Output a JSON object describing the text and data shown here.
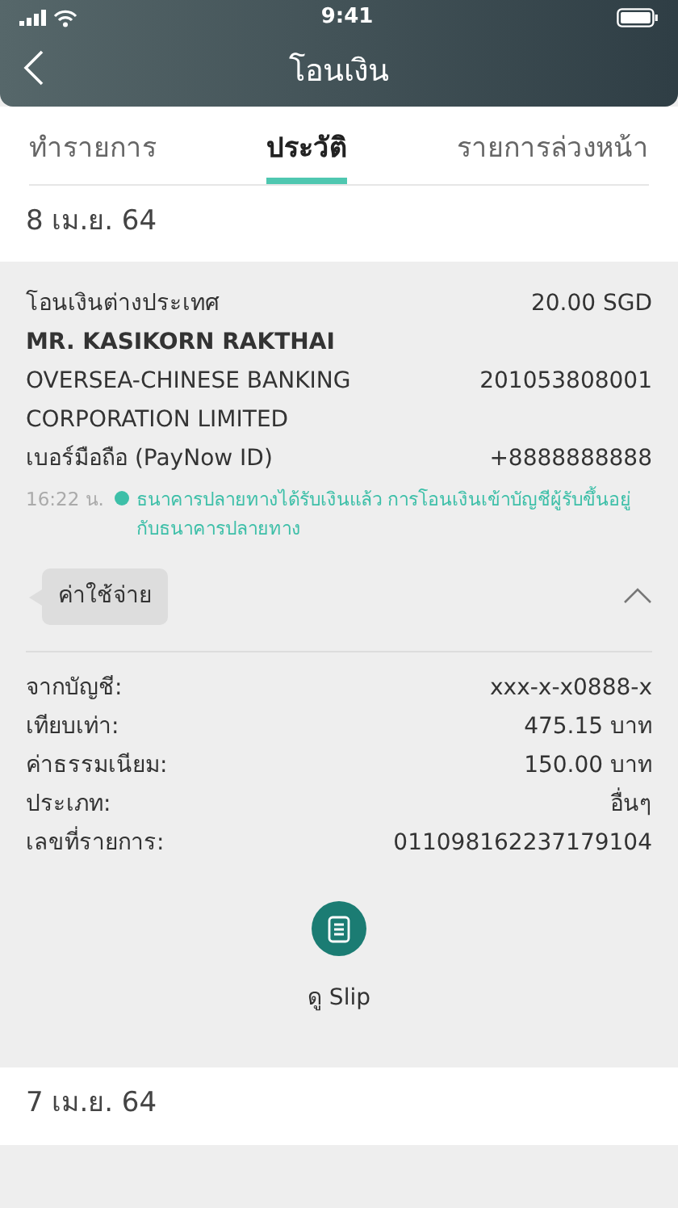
{
  "status_bar": {
    "time": "9:41"
  },
  "header": {
    "title": "โอนเงิน"
  },
  "tabs": [
    {
      "label": "ทำรายการ",
      "selected": false
    },
    {
      "label": "ประวัติ",
      "selected": true
    },
    {
      "label": "รายการล่วงหน้า",
      "selected": false
    }
  ],
  "sections": [
    {
      "date": "8 เม.ย. 64",
      "transactions": [
        {
          "title": "โอนเงินต่างประเทศ",
          "amount": "20.00 SGD",
          "recipient": "MR. KASIKORN RAKTHAI",
          "bank": "OVERSEA-CHINESE BANKING CORPORATION LIMITED",
          "account": "201053808001",
          "id_label": "เบอร์มือถือ (PayNow ID)",
          "id_value": "+8888888888",
          "status": {
            "time": "16:22 น.",
            "color": "#3dbfa8",
            "text": "ธนาคารปลายทางได้รับเงินแล้ว การโอนเงินเข้าบัญชีผู้รับขึ้นอยู่กับธนาคารปลายทาง"
          },
          "tag": "ค่าใช้จ่าย",
          "expanded": true,
          "details": [
            {
              "label": "จากบัญชี:",
              "value": "xxx-x-x0888-x"
            },
            {
              "label": "เทียบเท่า:",
              "value": "475.15 บาท"
            },
            {
              "label": "ค่าธรรมเนียม:",
              "value": "150.00 บาท"
            },
            {
              "label": "ประเภท:",
              "value": "อื่นๆ"
            },
            {
              "label": "เลขที่รายการ:",
              "value": "011098162237179104"
            }
          ],
          "slip_label": "ดู Slip"
        }
      ]
    },
    {
      "date": "7 เม.ย. 64"
    }
  ]
}
